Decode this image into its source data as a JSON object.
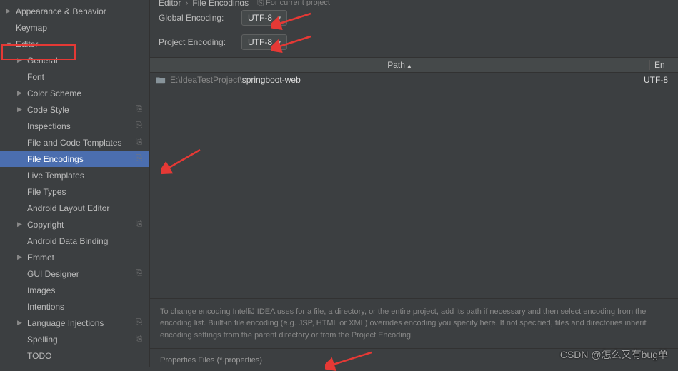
{
  "breadcrumb": {
    "cat": "Editor",
    "page": "File Encodings",
    "note": "For current project"
  },
  "sidebar": {
    "items": [
      {
        "label": "Appearance & Behavior",
        "expandable": true,
        "level": 0
      },
      {
        "label": "Keymap",
        "expandable": false,
        "level": 0
      },
      {
        "label": "Editor",
        "expandable": true,
        "expanded": true,
        "level": 0,
        "highlight": true
      },
      {
        "label": "General",
        "expandable": true,
        "level": 1
      },
      {
        "label": "Font",
        "expandable": false,
        "level": 1
      },
      {
        "label": "Color Scheme",
        "expandable": true,
        "level": 1
      },
      {
        "label": "Code Style",
        "expandable": true,
        "level": 1,
        "badge": true
      },
      {
        "label": "Inspections",
        "expandable": false,
        "level": 1,
        "badge": true
      },
      {
        "label": "File and Code Templates",
        "expandable": false,
        "level": 1,
        "badge": true
      },
      {
        "label": "File Encodings",
        "expandable": false,
        "level": 1,
        "badge": true,
        "selected": true
      },
      {
        "label": "Live Templates",
        "expandable": false,
        "level": 1
      },
      {
        "label": "File Types",
        "expandable": false,
        "level": 1
      },
      {
        "label": "Android Layout Editor",
        "expandable": false,
        "level": 1
      },
      {
        "label": "Copyright",
        "expandable": true,
        "level": 1,
        "badge": true
      },
      {
        "label": "Android Data Binding",
        "expandable": false,
        "level": 1
      },
      {
        "label": "Emmet",
        "expandable": true,
        "level": 1
      },
      {
        "label": "GUI Designer",
        "expandable": false,
        "level": 1,
        "badge": true
      },
      {
        "label": "Images",
        "expandable": false,
        "level": 1
      },
      {
        "label": "Intentions",
        "expandable": false,
        "level": 1
      },
      {
        "label": "Language Injections",
        "expandable": true,
        "level": 1,
        "badge": true
      },
      {
        "label": "Spelling",
        "expandable": false,
        "level": 1,
        "badge": true
      },
      {
        "label": "TODO",
        "expandable": false,
        "level": 1
      }
    ]
  },
  "form": {
    "global_label": "Global Encoding:",
    "global_value": "UTF-8",
    "project_label": "Project Encoding:",
    "project_value": "UTF-8"
  },
  "table": {
    "col_path": "Path",
    "col_enc_short": "En",
    "rows": [
      {
        "prefix": "E:\\IdeaTestProject\\",
        "name": "springboot-web",
        "encoding": "UTF-8"
      }
    ]
  },
  "hint": "To change encoding IntelliJ IDEA uses for a file, a directory, or the entire project, add its path if necessary and then select encoding from the encoding list. Built-in file encoding (e.g. JSP, HTML or XML) overrides encoding you specify here. If not specified, files and directories inherit encoding settings from the parent directory or from the Project Encoding.",
  "properties_section": "Properties Files (*.properties)",
  "watermark": "CSDN @怎么又有bug单"
}
